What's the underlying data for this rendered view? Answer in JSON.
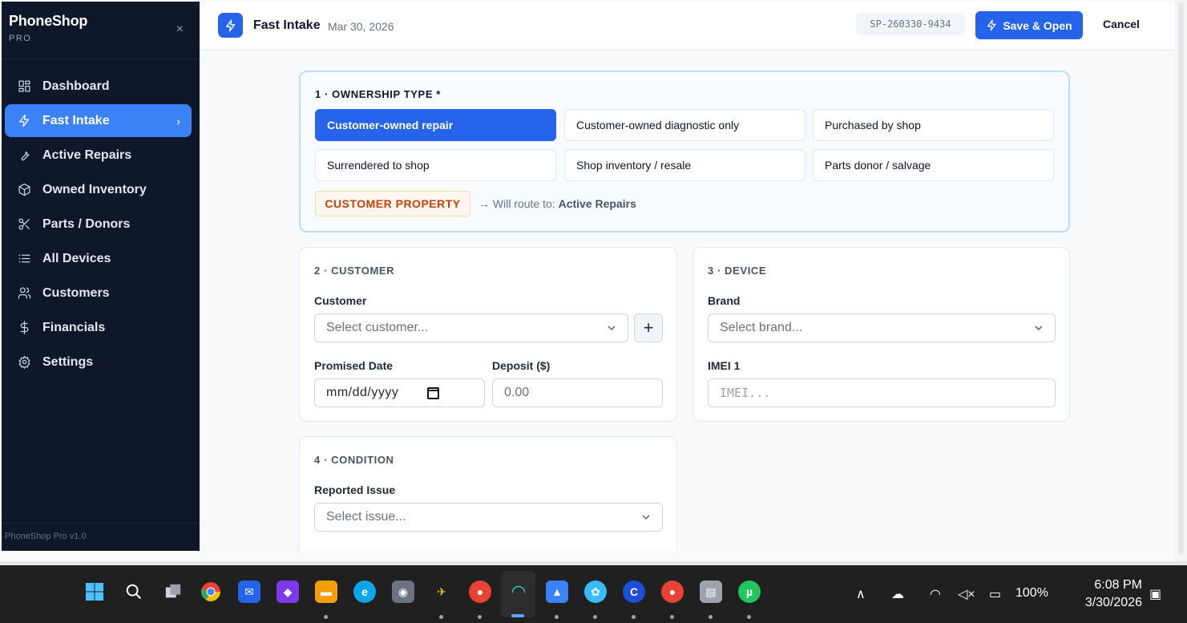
{
  "sidebar": {
    "brand": "PhoneShop",
    "brand_sub": "PRO",
    "close_glyph": "×",
    "items": [
      {
        "label": "Dashboard",
        "icon": "dashboard-icon"
      },
      {
        "label": "Fast Intake",
        "icon": "bolt-icon",
        "active": true
      },
      {
        "label": "Active Repairs",
        "icon": "wrench-icon"
      },
      {
        "label": "Owned Inventory",
        "icon": "box-icon"
      },
      {
        "label": "Parts / Donors",
        "icon": "scissors-icon"
      },
      {
        "label": "All Devices",
        "icon": "list-icon"
      },
      {
        "label": "Customers",
        "icon": "users-icon"
      },
      {
        "label": "Financials",
        "icon": "dollar-icon"
      },
      {
        "label": "Settings",
        "icon": "gear-icon"
      }
    ],
    "footer": "PhoneShop Pro v1.0"
  },
  "header": {
    "title": "Fast Intake",
    "date": "Mar 30, 2026",
    "ref": "SP-260330-9434",
    "save_label": "Save & Open",
    "cancel_label": "Cancel"
  },
  "ownership": {
    "title": "1 · OWNERSHIP TYPE *",
    "options": [
      "Customer-owned repair",
      "Customer-owned diagnostic only",
      "Purchased by shop",
      "Surrendered to shop",
      "Shop inventory / resale",
      "Parts donor / salvage"
    ],
    "selected": "Customer-owned repair",
    "badge": "CUSTOMER PROPERTY",
    "route_prefix": "→ Will route to:",
    "route_target": "Active Repairs"
  },
  "customer": {
    "title": "2 · CUSTOMER",
    "customer_label": "Customer",
    "customer_placeholder": "Select customer...",
    "add_glyph": "+",
    "promised_label": "Promised Date",
    "promised_value": "mm/dd/yyyy",
    "deposit_label": "Deposit ($)",
    "deposit_placeholder": "0.00"
  },
  "device": {
    "title": "3 · DEVICE",
    "brand_label": "Brand",
    "brand_placeholder": "Select brand...",
    "imei_label": "IMEI 1",
    "imei_placeholder": "IMEI..."
  },
  "condition": {
    "title": "4 · CONDITION",
    "issue_label": "Reported Issue",
    "issue_placeholder": "Select issue..."
  },
  "taskbar": {
    "battery": "100%",
    "time": "6:08 PM",
    "date": "3/30/2026"
  },
  "colors": {
    "sidebar_bg": "#0f172a",
    "accent": "#2563eb",
    "badge_text": "#c2410c",
    "badge_bg": "#fff7ed"
  }
}
